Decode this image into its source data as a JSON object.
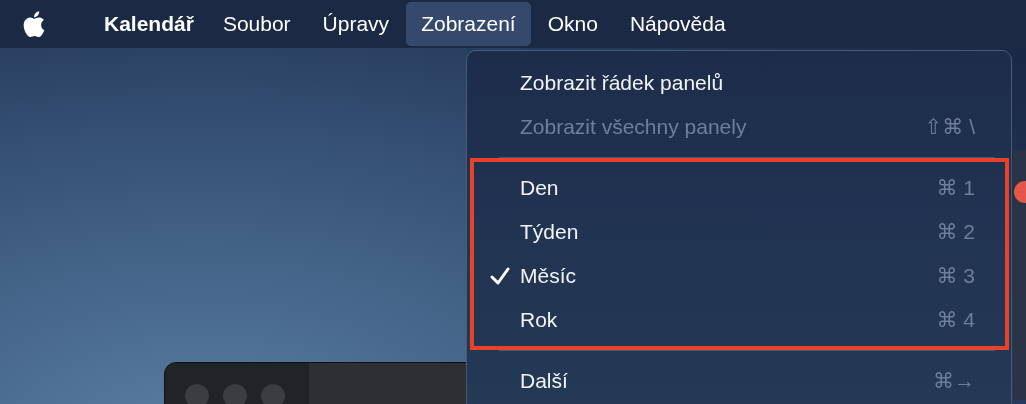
{
  "menu_bar": {
    "app_name": "Kalendář",
    "items": [
      {
        "label": "Soubor",
        "selected": false
      },
      {
        "label": "Úpravy",
        "selected": false
      },
      {
        "label": "Zobrazení",
        "selected": true
      },
      {
        "label": "Okno",
        "selected": false
      },
      {
        "label": "Nápověda",
        "selected": false
      }
    ]
  },
  "menu": {
    "sections": [
      {
        "highlighted": false,
        "items": [
          {
            "label": "Zobrazit řádek panelů",
            "disabled": false,
            "checked": false
          },
          {
            "label": "Zobrazit všechny panely",
            "shortcut": "⇧⌘ \\",
            "disabled": true,
            "checked": false
          }
        ]
      },
      {
        "highlighted": true,
        "items": [
          {
            "label": "Den",
            "shortcut": "⌘ 1",
            "disabled": false,
            "checked": false
          },
          {
            "label": "Týden",
            "shortcut": "⌘ 2",
            "disabled": false,
            "checked": false
          },
          {
            "label": "Měsíc",
            "shortcut": "⌘ 3",
            "disabled": false,
            "checked": true
          },
          {
            "label": "Rok",
            "shortcut": "⌘ 4",
            "disabled": false,
            "checked": false
          }
        ]
      },
      {
        "highlighted": false,
        "items": [
          {
            "label": "Další",
            "shortcut": "⌘→",
            "disabled": false,
            "checked": false
          }
        ]
      }
    ]
  }
}
